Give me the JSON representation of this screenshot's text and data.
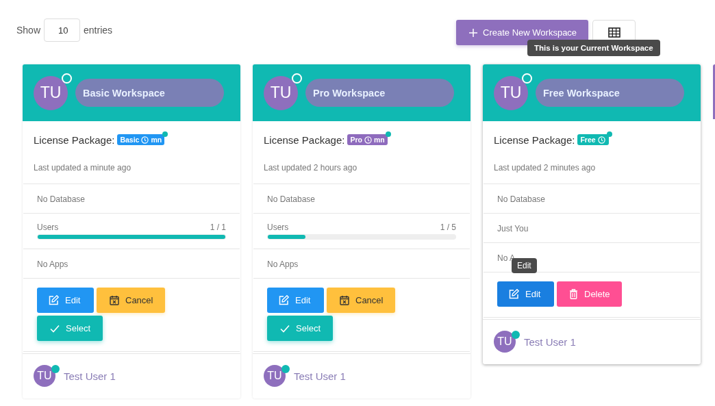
{
  "toolbar": {
    "show_label": "Show",
    "page_size": "10",
    "entries_label": "entries",
    "create_button": "Create New Workspace",
    "tooltip": "This is your Current Workspace"
  },
  "cards": [
    {
      "initials": "TU",
      "title": "Basic Workspace",
      "current": false,
      "license_label": "License Package:",
      "badge": {
        "label": "Basic",
        "suffix": "mn",
        "color": "#2196f3"
      },
      "updated": "Last updated a minute ago",
      "rows": [
        {
          "kind": "text",
          "text": "No Database"
        },
        {
          "kind": "meter",
          "label": "Users",
          "reading": "1 / 1",
          "level": 1
        },
        {
          "kind": "text",
          "text": "No Apps"
        }
      ],
      "buttons": [
        {
          "kind": "edit",
          "label": "Edit"
        },
        {
          "kind": "cancel",
          "label": "Cancel"
        },
        {
          "kind": "select",
          "label": "Select"
        }
      ],
      "owner": {
        "initials": "TU",
        "name": "Test User 1"
      }
    },
    {
      "initials": "TU",
      "title": "Pro Workspace",
      "current": false,
      "license_label": "License Package:",
      "badge": {
        "label": "Pro",
        "suffix": "mn",
        "color": "#8e6bbd"
      },
      "updated": "Last updated 2 hours ago",
      "rows": [
        {
          "kind": "text",
          "text": "No Database"
        },
        {
          "kind": "meter",
          "label": "Users",
          "reading": "1 / 5",
          "level": 0.2
        },
        {
          "kind": "text",
          "text": "No Apps"
        }
      ],
      "buttons": [
        {
          "kind": "edit",
          "label": "Edit"
        },
        {
          "kind": "cancel",
          "label": "Cancel"
        },
        {
          "kind": "select",
          "label": "Select"
        }
      ],
      "owner": {
        "initials": "TU",
        "name": "Test User 1"
      }
    },
    {
      "initials": "TU",
      "title": "Free Workspace",
      "current": true,
      "license_label": "License Package:",
      "badge": {
        "label": "Free",
        "color": "#10b9b2"
      },
      "updated": "Last updated 2 minutes ago",
      "rows": [
        {
          "kind": "text",
          "text": "No Database"
        },
        {
          "kind": "text",
          "text": "Just You"
        },
        {
          "kind": "text",
          "text": "No A"
        }
      ],
      "buttons": [
        {
          "kind": "edit",
          "label": "Edit",
          "tooltip": "Edit"
        },
        {
          "kind": "delete",
          "label": "Delete"
        }
      ],
      "owner": {
        "initials": "TU",
        "name": "Test User 1"
      }
    }
  ]
}
